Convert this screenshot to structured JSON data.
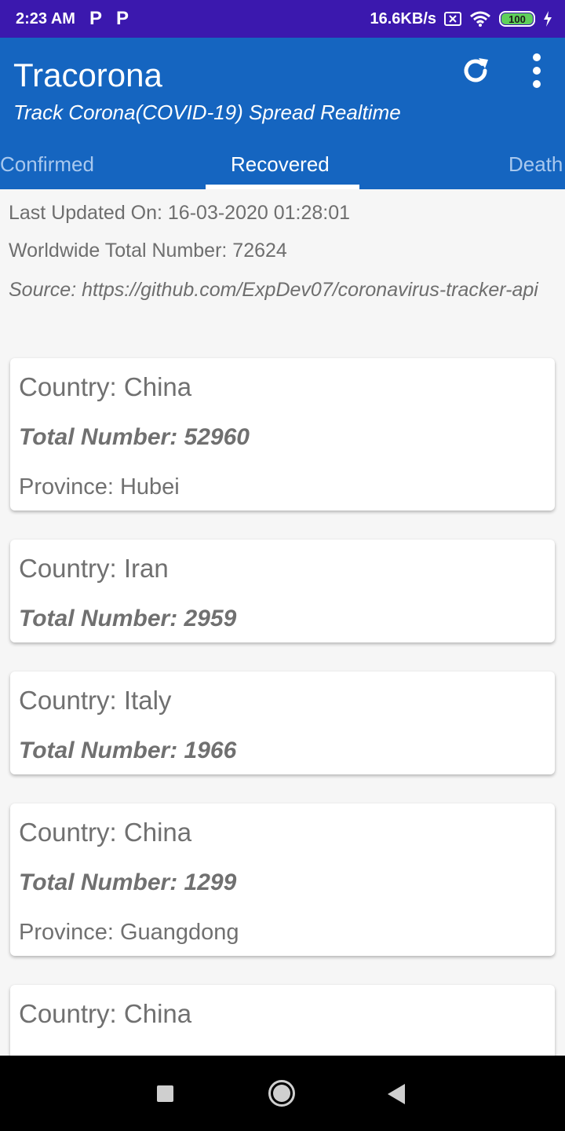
{
  "status_bar": {
    "time": "2:23 AM",
    "p_icons": [
      "P",
      "P"
    ],
    "speed": "16.6KB/s",
    "battery": "100"
  },
  "app": {
    "title": "Tracorona",
    "subtitle": "Track Corona(COVID-19) Spread Realtime",
    "refresh_icon": "refresh-icon",
    "menu_icon": "more-vert-icon"
  },
  "tabs": [
    {
      "label": "Confirmed",
      "selected": false
    },
    {
      "label": "Recovered",
      "selected": true
    },
    {
      "label": "Death",
      "selected": false
    }
  ],
  "info": {
    "last_updated": "Last Updated On: 16-03-2020 01:28:01",
    "worldwide_total": "Worldwide Total Number: 72624",
    "source": "Source: https://github.com/ExpDev07/coronavirus-tracker-api"
  },
  "cards": [
    {
      "country": "Country: China",
      "total": "Total Number: 52960",
      "province": "Province: Hubei"
    },
    {
      "country": "Country: Iran",
      "total": "Total Number: 2959",
      "province": ""
    },
    {
      "country": "Country: Italy",
      "total": "Total Number: 1966",
      "province": ""
    },
    {
      "country": "Country: China",
      "total": "Total Number: 1299",
      "province": "Province: Guangdong"
    },
    {
      "country": "Country: China",
      "total": "",
      "province": ""
    }
  ],
  "colors": {
    "status_bar": "#3b18ae",
    "app_bar": "#1565c0",
    "background": "#f6f6f6",
    "card_text": "#707070"
  }
}
